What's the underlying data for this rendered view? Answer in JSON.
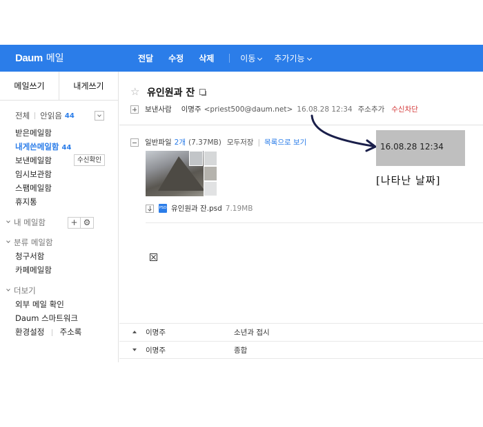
{
  "header": {
    "logo_mark": "Daum",
    "logo_text": "메일",
    "actions": [
      "전달",
      "수정",
      "삭제"
    ],
    "dropdowns": [
      "이동",
      "추가기능"
    ]
  },
  "sidebar": {
    "compose": "메일쓰기",
    "compose_self": "내게쓰기",
    "all_label": "전체",
    "unread_label": "안읽음",
    "unread_count": "44",
    "items": [
      {
        "label": "받은메일함"
      },
      {
        "label": "내게쓴메일함",
        "count": "44"
      },
      {
        "label": "보낸메일함",
        "button": "수신확인"
      },
      {
        "label": "임시보관함"
      },
      {
        "label": "스팸메일함"
      },
      {
        "label": "휴지통"
      }
    ],
    "my_mailbox": "내 메일함",
    "category_mailbox": "분류 메일함",
    "category_items": [
      "청구서함",
      "카페메일함"
    ],
    "more": "더보기",
    "more_items": [
      "외부 메일 확인",
      "Daum 스마트워크"
    ],
    "settings": "환경설정",
    "address_book": "주소록"
  },
  "mail": {
    "subject": "유인원과 잔",
    "sender_label": "보낸사람",
    "sender_name": "이명주",
    "sender_email": "<priest500@daum.net>",
    "date": "16.08.28 12:34",
    "add_address": "주소추가",
    "block": "수신차단",
    "attach_label": "일반파일",
    "attach_count": "2개",
    "attach_size": "(7.37MB)",
    "save_all": "모두저장",
    "list_view": "목록으로 보기",
    "file_name": "유인원과 잔.psd",
    "file_size": "7.19MB",
    "file_type": "PSD"
  },
  "nav_list": [
    {
      "from": "이명주",
      "subject": "소년과 접시"
    },
    {
      "from": "이명주",
      "subject": "종합"
    }
  ],
  "annotation": {
    "date_zoom": "16.08.28 12:34",
    "note": "[나타난 날짜]"
  },
  "colors": {
    "header_blue": "#2b7de9",
    "accent_blue": "#2b7de9",
    "block_red": "#d43a3a",
    "highlight_gray": "#bfbfbf"
  }
}
